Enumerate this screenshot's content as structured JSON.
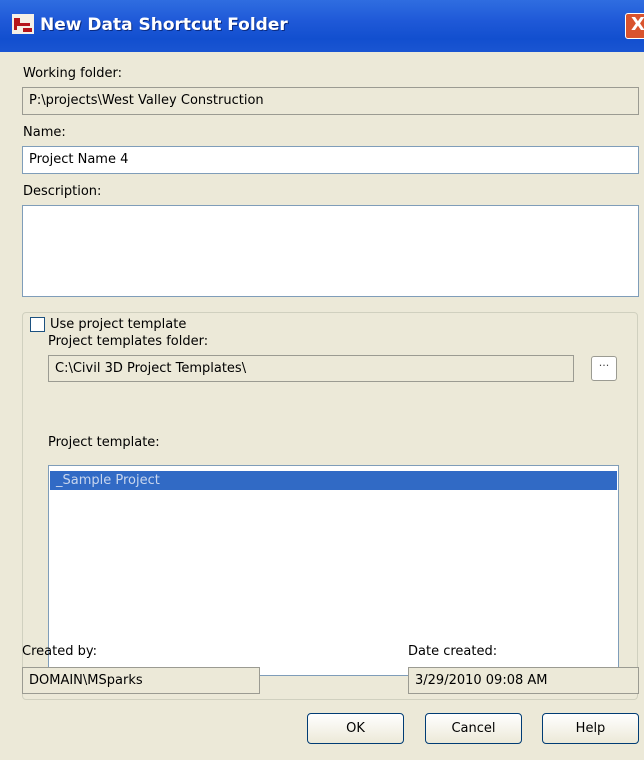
{
  "window": {
    "title": "New Data Shortcut Folder",
    "close_glyph": "X"
  },
  "working_folder": {
    "label": "Working folder:",
    "value": "P:\\projects\\West Valley Construction"
  },
  "name": {
    "label": "Name:",
    "value": "Project Name 4"
  },
  "description": {
    "label": "Description:",
    "value": ""
  },
  "use_template": {
    "label": "Use project template",
    "checked": false
  },
  "templates_folder": {
    "label": "Project templates folder:",
    "value": "C:\\Civil 3D Project Templates\\",
    "browse_glyph": "···"
  },
  "project_template": {
    "label": "Project template:",
    "items": [
      "_Sample Project"
    ],
    "selected": "_Sample Project"
  },
  "created_by": {
    "label": "Created by:",
    "value": "DOMAIN\\MSparks"
  },
  "date_created": {
    "label": "Date created:",
    "value": "3/29/2010 09:08 AM"
  },
  "buttons": {
    "ok": "OK",
    "cancel": "Cancel",
    "help": "Help"
  },
  "icons": {
    "app": "civil3d-app-icon",
    "close": "close-icon",
    "browse": "ellipsis-icon"
  },
  "colors": {
    "titlebar": "#1f59d8",
    "selection": "#316ac5",
    "dialog_bg": "#ece9d8"
  }
}
